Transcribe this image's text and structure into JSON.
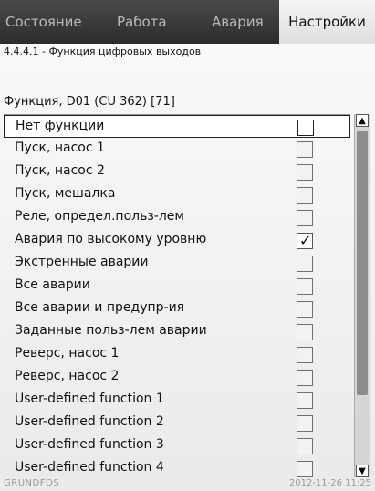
{
  "tabs": [
    {
      "label": "Состояние",
      "active": false
    },
    {
      "label": "Работа",
      "active": false
    },
    {
      "label": "Авария",
      "active": false
    },
    {
      "label": "Настройки",
      "active": true
    }
  ],
  "breadcrumb": "4.4.4.1 - Функция цифровых выходов",
  "function_label": "Функция, D01 (CU 362) [71]",
  "items": [
    {
      "label": "Нет функции",
      "checked": false,
      "selected": true
    },
    {
      "label": "Пуск, насос 1",
      "checked": false,
      "selected": false
    },
    {
      "label": "Пуск, насос 2",
      "checked": false,
      "selected": false
    },
    {
      "label": "Пуск, мешалка",
      "checked": false,
      "selected": false
    },
    {
      "label": "Реле, определ.польз-лем",
      "checked": false,
      "selected": false
    },
    {
      "label": "Авария по высокому уровню",
      "checked": true,
      "selected": false
    },
    {
      "label": "Экстренные аварии",
      "checked": false,
      "selected": false
    },
    {
      "label": "Все аварии",
      "checked": false,
      "selected": false
    },
    {
      "label": "Все аварии и предупр-ия",
      "checked": false,
      "selected": false
    },
    {
      "label": "Заданные польз-лем аварии",
      "checked": false,
      "selected": false
    },
    {
      "label": "Реверс, насос 1",
      "checked": false,
      "selected": false
    },
    {
      "label": "Реверс, насос 2",
      "checked": false,
      "selected": false
    },
    {
      "label": "User-defined function 1",
      "checked": false,
      "selected": false
    },
    {
      "label": "User-defined function 2",
      "checked": false,
      "selected": false
    },
    {
      "label": "User-defined function 3",
      "checked": false,
      "selected": false
    },
    {
      "label": "User-defined function 4",
      "checked": false,
      "selected": false
    }
  ],
  "checkmark_glyph": "✓",
  "scroll_up_glyph": "▲",
  "scroll_down_glyph": "▼",
  "footer": {
    "brand": "GRUNDFOS",
    "datetime": "2012-11-26 11:25"
  }
}
